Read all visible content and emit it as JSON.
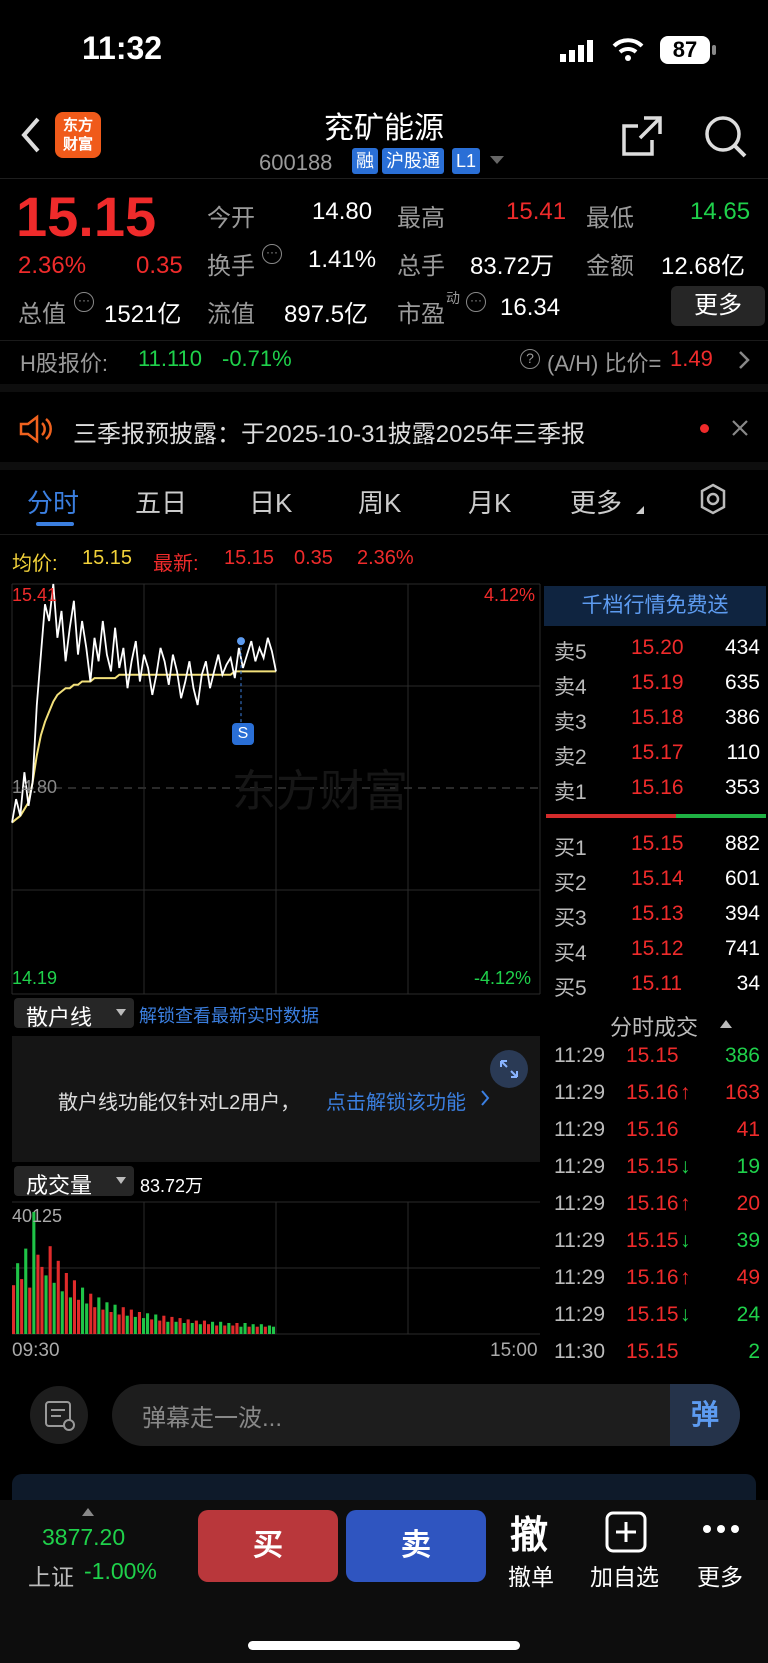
{
  "status_bar": {
    "time": "11:32",
    "battery": "87"
  },
  "header": {
    "logo": "东方\n财富",
    "logo_line1": "东方",
    "logo_line2": "财富",
    "title": "兖矿能源",
    "code": "600188",
    "tags": [
      "融",
      "沪股通",
      "L1"
    ]
  },
  "quote": {
    "price": "15.15",
    "change_pct": "2.36%",
    "change": "0.35",
    "fields": [
      {
        "label": "今开",
        "value": "14.80",
        "color": "white"
      },
      {
        "label": "最高",
        "value": "15.41",
        "color": "red"
      },
      {
        "label": "最低",
        "value": "14.65",
        "color": "green"
      },
      {
        "label": "换手",
        "value": "1.41%",
        "color": "white"
      },
      {
        "label": "总手",
        "value": "83.72万",
        "color": "white"
      },
      {
        "label": "金额",
        "value": "12.68亿",
        "color": "white"
      },
      {
        "label": "总值",
        "value": "1521亿",
        "color": "white"
      },
      {
        "label": "流值",
        "value": "897.5亿",
        "color": "white"
      },
      {
        "label": "市盈",
        "sup": "动",
        "value": "16.34",
        "color": "white"
      }
    ],
    "more_button": "更多"
  },
  "hshare": {
    "label": "H股报价:",
    "price": "11.110",
    "change": "-0.71%",
    "ah_label": "(A/H) 比价=",
    "ah_value": "1.49"
  },
  "notice": {
    "text": "三季报预披露：于2025-10-31披露2025年三季报"
  },
  "tabs": [
    {
      "label": "分时",
      "active": true
    },
    {
      "label": "五日"
    },
    {
      "label": "日K"
    },
    {
      "label": "周K"
    },
    {
      "label": "月K"
    },
    {
      "label": "更多"
    }
  ],
  "chart_info": {
    "avg_label": "均价:",
    "avg_value": "15.15",
    "latest_label": "最新:",
    "latest_value": "15.15",
    "latest_change": "0.35",
    "latest_pct": "2.36%"
  },
  "chart_data": {
    "type": "line",
    "y_top": "15.41",
    "y_mid": "14.80",
    "y_bottom": "14.19",
    "pct_top": "4.12%",
    "pct_bottom": "-4.12%",
    "ylim": [
      14.19,
      15.41
    ],
    "x_start": "09:30",
    "x_end": "15:00",
    "marker": "S",
    "watermark": "东方财富",
    "series": [
      {
        "values": [
          14.7,
          14.77,
          14.72,
          14.85,
          14.75,
          14.82,
          15.05,
          15.2,
          15.35,
          15.3,
          15.41,
          15.25,
          15.33,
          15.18,
          15.28,
          15.36,
          15.2,
          15.3,
          15.22,
          15.12,
          15.25,
          15.18,
          15.3,
          15.2,
          15.15,
          15.28,
          15.16,
          15.22,
          15.1,
          15.18,
          15.24,
          15.12,
          15.2,
          15.16,
          15.08,
          15.14,
          15.22,
          15.18,
          15.11,
          15.2,
          15.15,
          15.07,
          15.12,
          15.18,
          15.1,
          15.05,
          15.14,
          15.18,
          15.1,
          15.15,
          15.2,
          15.14,
          15.17,
          15.19,
          15.13,
          15.22,
          15.16,
          15.2,
          15.24,
          15.18,
          15.22,
          15.19,
          15.25,
          15.21,
          15.15
        ]
      },
      {
        "values": [
          14.7,
          14.71,
          14.72,
          14.74,
          14.76,
          14.82,
          14.9,
          14.96,
          15.0,
          15.03,
          15.06,
          15.08,
          15.09,
          15.1,
          15.1,
          15.11,
          15.11,
          15.12,
          15.12,
          15.12,
          15.13,
          15.13,
          15.13,
          15.13,
          15.13,
          15.13,
          15.14,
          15.14,
          15.14,
          15.14,
          15.14,
          15.14,
          15.14,
          15.14,
          15.14,
          15.14,
          15.14,
          15.14,
          15.14,
          15.14,
          15.14,
          15.14,
          15.14,
          15.14,
          15.14,
          15.14,
          15.14,
          15.14,
          15.14,
          15.14,
          15.14,
          15.14,
          15.14,
          15.14,
          15.15,
          15.15,
          15.15,
          15.15,
          15.15,
          15.15,
          15.15,
          15.15,
          15.15,
          15.15,
          15.15
        ]
      }
    ],
    "volume_label": "成交量",
    "volume_total": "83.72万",
    "volume_max": "40125",
    "volume": [
      40,
      58,
      45,
      70,
      38,
      100,
      65,
      55,
      48,
      72,
      42,
      60,
      35,
      50,
      30,
      44,
      28,
      38,
      25,
      33,
      22,
      30,
      20,
      26,
      18,
      24,
      16,
      22,
      15,
      20,
      14,
      18,
      13,
      17,
      12,
      16,
      11,
      15,
      10,
      14,
      10,
      13,
      9,
      12,
      9,
      11,
      8,
      11,
      8,
      10,
      7,
      10,
      7,
      9,
      7,
      9,
      6,
      9,
      6,
      8,
      6,
      8,
      6,
      7,
      6
    ],
    "volume_colors": "rgrgrgrrgrgrgrgrrggrrgrgrgrrgrgrggrgrrgrgrgrgrgrrgrgrgrrggrgrgr"
  },
  "retail": {
    "label": "散户线",
    "unlock": "解锁查看最新实时数据",
    "msg": "散户线功能仅针对L2用户，",
    "link": "点击解锁该功能"
  },
  "orderbook": {
    "promo": "千档行情免费送",
    "asks": [
      {
        "label": "卖5",
        "price": "15.20",
        "vol": "434"
      },
      {
        "label": "卖4",
        "price": "15.19",
        "vol": "635"
      },
      {
        "label": "卖3",
        "price": "15.18",
        "vol": "386"
      },
      {
        "label": "卖2",
        "price": "15.17",
        "vol": "110"
      },
      {
        "label": "卖1",
        "price": "15.16",
        "vol": "353"
      }
    ],
    "bids": [
      {
        "label": "买1",
        "price": "15.15",
        "vol": "882"
      },
      {
        "label": "买2",
        "price": "15.14",
        "vol": "601"
      },
      {
        "label": "买3",
        "price": "15.13",
        "vol": "394"
      },
      {
        "label": "买4",
        "price": "15.12",
        "vol": "741"
      },
      {
        "label": "买5",
        "price": "15.11",
        "vol": "34"
      }
    ]
  },
  "trades": {
    "title": "分时成交",
    "rows": [
      {
        "time": "11:29",
        "price": "15.15",
        "arrow": "",
        "vol": "386",
        "color": "green"
      },
      {
        "time": "11:29",
        "price": "15.16",
        "arrow": "↑",
        "vol": "163",
        "color": "red"
      },
      {
        "time": "11:29",
        "price": "15.16",
        "arrow": "",
        "vol": "41",
        "color": "red"
      },
      {
        "time": "11:29",
        "price": "15.15",
        "arrow": "↓",
        "vol": "19",
        "color": "green"
      },
      {
        "time": "11:29",
        "price": "15.16",
        "arrow": "↑",
        "vol": "20",
        "color": "red"
      },
      {
        "time": "11:29",
        "price": "15.15",
        "arrow": "↓",
        "vol": "39",
        "color": "green"
      },
      {
        "time": "11:29",
        "price": "15.16",
        "arrow": "↑",
        "vol": "49",
        "color": "red"
      },
      {
        "time": "11:29",
        "price": "15.15",
        "arrow": "↓",
        "vol": "24",
        "color": "green"
      },
      {
        "time": "11:30",
        "price": "15.15",
        "arrow": "",
        "vol": "2",
        "color": "green"
      }
    ]
  },
  "danmu": {
    "placeholder": "弹幕走一波...",
    "button": "弹"
  },
  "bottom": {
    "index_value": "3877.20",
    "index_name": "上证",
    "index_change": "-1.00%",
    "buy": "买",
    "sell": "卖",
    "cancel_icon": "撤",
    "cancel": "撤单",
    "add": "加自选",
    "more": "更多"
  }
}
